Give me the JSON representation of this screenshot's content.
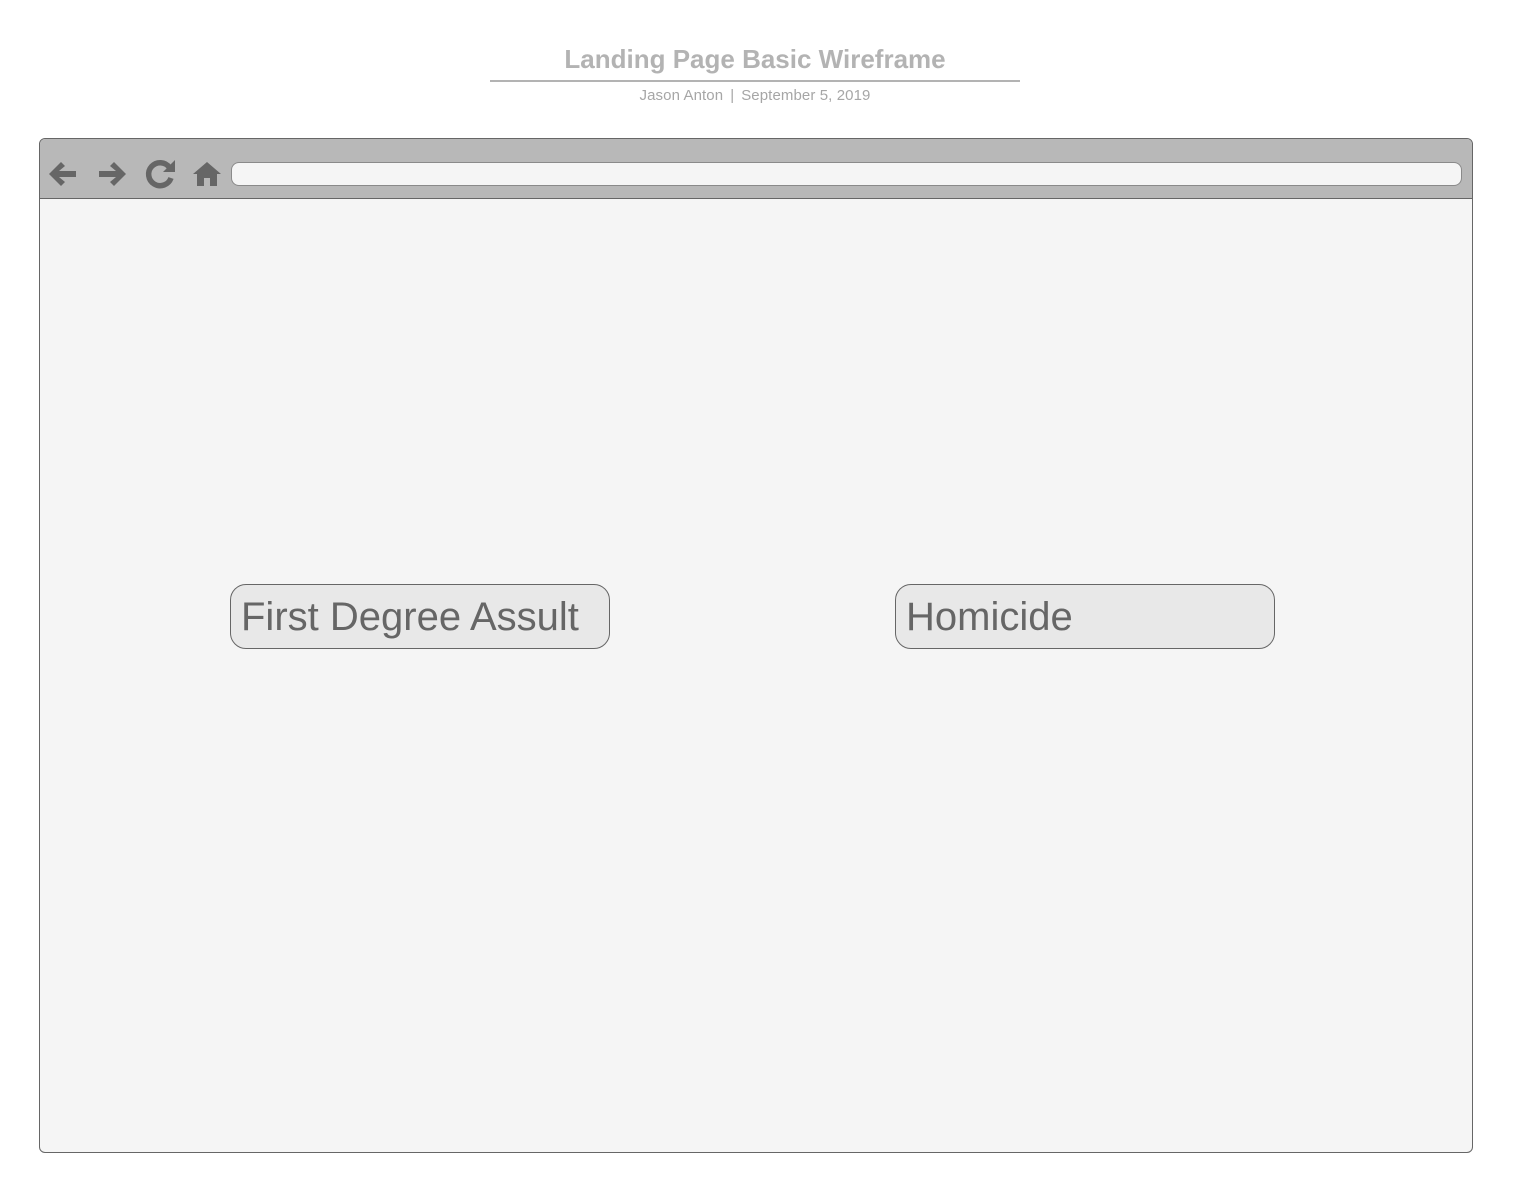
{
  "header": {
    "title": "Landing Page Basic Wireframe",
    "author": "Jason Anton",
    "separator": "|",
    "date": "September 5, 2019"
  },
  "browser": {
    "toolbar": {
      "icons": [
        "back-arrow-icon",
        "forward-arrow-icon",
        "refresh-icon",
        "home-icon"
      ],
      "url": ""
    }
  },
  "content": {
    "buttons": [
      {
        "label": "First Degree Assult"
      },
      {
        "label": "Homicide"
      }
    ]
  },
  "colors": {
    "toolbar": "#b8b8b8",
    "canvas": "#f5f5f5",
    "button_fill": "#e8e8e8",
    "outline": "#666666",
    "header_text": "#b3b3b3"
  }
}
